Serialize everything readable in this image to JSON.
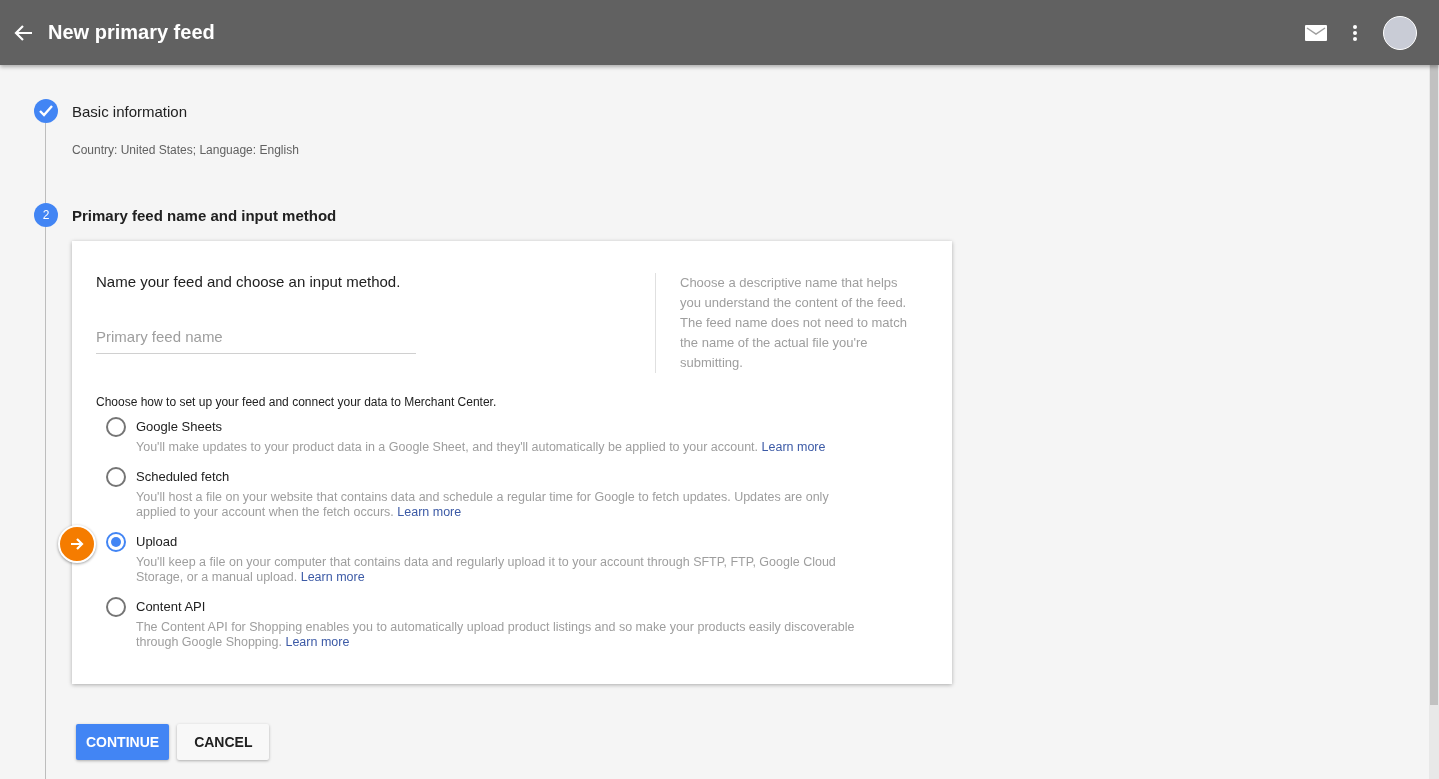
{
  "header": {
    "title": "New primary feed"
  },
  "steps": [
    {
      "kind": "done",
      "title": "Basic information",
      "summary": "Country: United States; Language: English"
    },
    {
      "kind": "active",
      "number": "2",
      "title": "Primary feed name and input method"
    }
  ],
  "card": {
    "intro": "Name your feed and choose an input method.",
    "name_field": {
      "placeholder": "Primary feed name"
    },
    "help": "Choose a descriptive name that helps you understand the content of the feed. The feed name does not need to match the name of the actual file you're submitting.",
    "methods_prompt": "Choose how to set up your feed and connect your data to Merchant Center.",
    "methods": [
      {
        "label": "Google Sheets",
        "selected": false,
        "description": "You'll make updates to your product data in a Google Sheet, and they'll automatically be applied to your account.",
        "link": "Learn more"
      },
      {
        "label": "Scheduled fetch",
        "selected": false,
        "description": "You'll host a file on your website that contains data and schedule a regular time for Google to fetch updates. Updates are only applied to your account when the fetch occurs.",
        "link": "Learn more"
      },
      {
        "label": "Upload",
        "selected": true,
        "description": "You'll keep a file on your computer that contains data and regularly upload it to your account through SFTP, FTP, Google Cloud Storage, or a manual upload.",
        "link": "Learn more"
      },
      {
        "label": "Content API",
        "selected": false,
        "description": "The Content API for Shopping enables you to automatically upload product listings and so make your products easily discoverable through Google Shopping.",
        "link": "Learn more"
      }
    ]
  },
  "buttons": [
    {
      "label": "CONTINUE",
      "kind": "primary"
    },
    {
      "label": "CANCEL",
      "kind": "secondary"
    }
  ]
}
